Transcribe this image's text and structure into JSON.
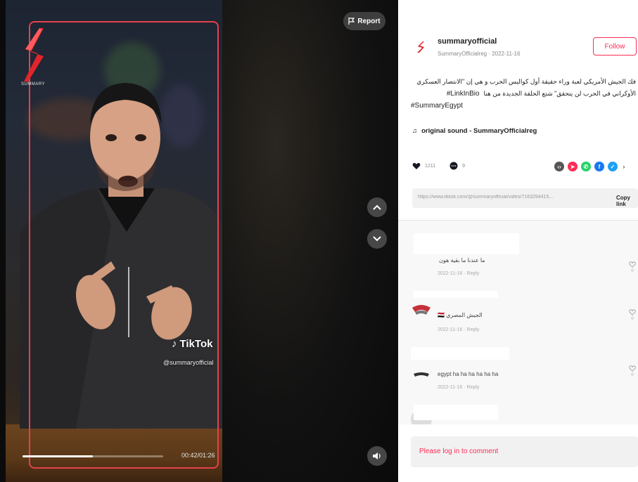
{
  "video": {
    "logo_caption": "SUMMARY",
    "watermark_brand": "TikTok",
    "watermark_handle": "@summaryofficial",
    "time_readout": "00:42/01:26",
    "progress_fraction": 0.5,
    "report_label": "Report",
    "icons": {
      "report": "flag-icon",
      "prev": "chevron-up-icon",
      "next": "chevron-down-icon",
      "volume": "volume-icon"
    }
  },
  "post": {
    "username": "summaryofficial",
    "user_meta": "SummaryOfficialreg · 2022-11-16",
    "follow_label": "Follow",
    "description_line1": "فك الجيش الأمريكي لعبة وراء حقيقة أول كواليس الحرب و هي إن \"الانتصار العسكري",
    "description_line2_text": "الأوكراني في الحرب لن يتحقق\" شتع الحلقة الجديدة من هنا",
    "hashtag_1": "#LinkInBio",
    "hashtag_2": "#SummaryEgypt",
    "music": "original sound - SummaryOfficialreg",
    "likes": "1211",
    "comments_count": "9",
    "link_url": "https://www.tiktok.com/@summaryofficial/video/7163294415...",
    "copy_link_label": "Copy link"
  },
  "comments": [
    {
      "text": "ما عندنا ما بقية هون",
      "meta": "2022-11-16 · Reply",
      "likes": "0"
    },
    {
      "text": "الجيش المصري 🇪🇬",
      "meta": "2022-11-16 · Reply",
      "likes": "0"
    },
    {
      "text": "egypt ha ha ha ha ha ha",
      "meta": "2022-11-16 · Reply",
      "likes": "0"
    }
  ],
  "login_prompt": "Please log in to comment",
  "colors": {
    "accent": "#fe2c55",
    "frame": "#e8404c"
  }
}
